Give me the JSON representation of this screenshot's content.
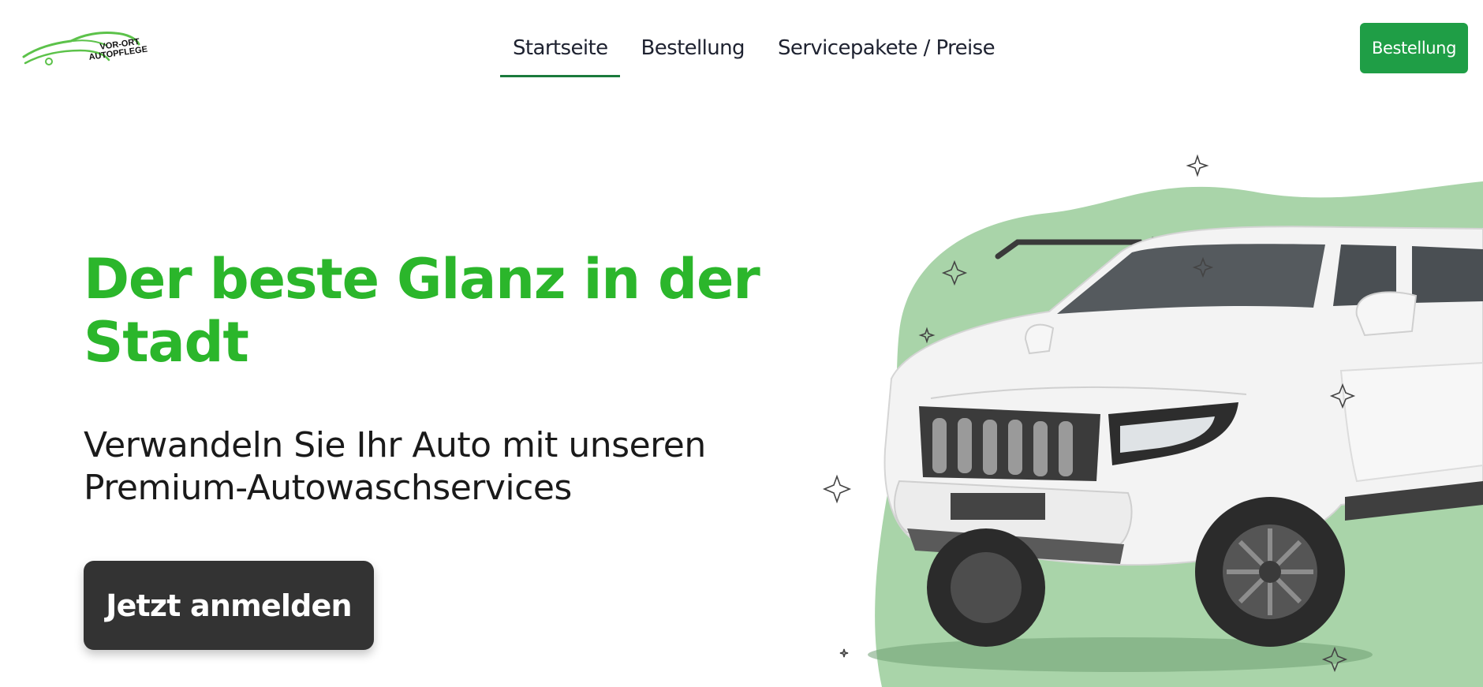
{
  "brand": {
    "logo_line1": "VOR-ORT",
    "logo_line2": "AUTOPFLEGE",
    "accent_color": "#2bb62b",
    "logo_color": "#5cc24a"
  },
  "nav": {
    "items": [
      {
        "label": "Startseite",
        "active": true
      },
      {
        "label": "Bestellung",
        "active": false
      },
      {
        "label": "Servicepakete / Preise",
        "active": false
      }
    ],
    "underline_color": "#1a7a3c"
  },
  "header_button": {
    "label": "Bestellung",
    "color": "#1f9e46"
  },
  "hero": {
    "title": "Der beste Glanz in der Stadt",
    "subtitle": "Verwandeln Sie Ihr Auto mit unseren Premium-Autowaschservices",
    "cta_label": "Jetzt anmelden",
    "cta_color": "#333333",
    "blob_color": "#a9d4a9",
    "image": "white-suv-image",
    "decoration": "sparkle-icons"
  }
}
